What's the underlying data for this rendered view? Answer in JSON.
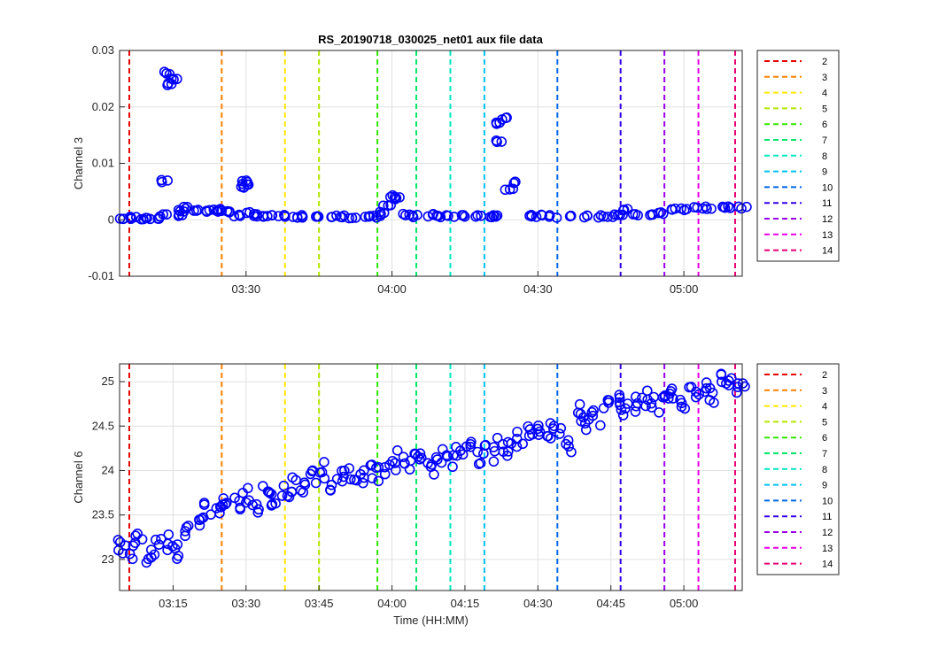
{
  "figure": {
    "title": "RS_20190718_030025_net01 aux file data"
  },
  "colors": {
    "data": "#0000ff",
    "grid": "#e0e0e0",
    "axes": "#262626"
  },
  "legend": {
    "placement": "outside-right",
    "entries": [
      {
        "label": "2",
        "color": "#e60000"
      },
      {
        "label": "3",
        "color": "#ff8000"
      },
      {
        "label": "4",
        "color": "#ffe600"
      },
      {
        "label": "5",
        "color": "#b3e600"
      },
      {
        "label": "6",
        "color": "#33e600"
      },
      {
        "label": "7",
        "color": "#00e666"
      },
      {
        "label": "8",
        "color": "#00e6c2"
      },
      {
        "label": "9",
        "color": "#00c2f0"
      },
      {
        "label": "10",
        "color": "#0066e6"
      },
      {
        "label": "11",
        "color": "#3300e6"
      },
      {
        "label": "12",
        "color": "#9900e6"
      },
      {
        "label": "13",
        "color": "#e600e6"
      },
      {
        "label": "14",
        "color": "#e60073"
      }
    ]
  },
  "chart_data": [
    {
      "type": "scatter",
      "ylabel": "Channel 3",
      "xlabel": "",
      "xlim": [
        "03:04",
        "05:12"
      ],
      "ylim": [
        -0.01,
        0.03
      ],
      "grid": true,
      "xticks": [
        "03:30",
        "04:00",
        "04:30",
        "05:00"
      ],
      "yticks": [
        {
          "value": -0.01,
          "label": "-0.01"
        },
        {
          "value": 0,
          "label": "0"
        },
        {
          "value": 0.01,
          "label": "0.01"
        },
        {
          "value": 0.02,
          "label": "0.02"
        },
        {
          "value": 0.03,
          "label": "0.03"
        }
      ],
      "event_lines": [
        "03:06",
        "03:25",
        "03:38",
        "03:45",
        "03:57",
        "04:05",
        "04:12",
        "04:19",
        "04:34",
        "04:47",
        "04:56",
        "05:03",
        "05:12"
      ],
      "series": [
        {
          "x": [
            "03:04",
            "03:06",
            "03:08",
            "03:10",
            "03:12",
            "03:13",
            "03:13",
            "03:14",
            "03:14",
            "03:15",
            "03:16",
            "03:17",
            "03:18",
            "03:20",
            "03:22",
            "03:24",
            "03:25",
            "03:26",
            "03:28",
            "03:29",
            "03:30",
            "03:30",
            "03:31",
            "03:32",
            "03:34",
            "03:36",
            "03:38",
            "03:40",
            "03:42",
            "03:45",
            "03:48",
            "03:50",
            "03:52",
            "03:55",
            "03:57",
            "03:58",
            "03:59",
            "04:00",
            "04:01",
            "04:03",
            "04:05",
            "04:08",
            "04:10",
            "04:12",
            "04:15",
            "04:18",
            "04:20",
            "04:21",
            "04:22",
            "04:22",
            "04:23",
            "04:24",
            "04:25",
            "04:28",
            "04:30",
            "04:33",
            "04:36",
            "04:40",
            "04:43",
            "04:45",
            "04:47",
            "04:48",
            "04:50",
            "04:53",
            "04:55",
            "04:58",
            "05:00",
            "05:03",
            "05:05",
            "05:08",
            "05:10",
            "05:12"
          ],
          "y": [
            0.0003,
            0.0003,
            0.0003,
            0.0003,
            0.0003,
            0.0008,
            0.0068,
            0.026,
            0.024,
            0.025,
            0.0008,
            0.0015,
            0.0022,
            0.0016,
            0.0016,
            0.0017,
            0.0016,
            0.0015,
            0.0007,
            0.0058,
            0.0062,
            0.0068,
            0.0012,
            0.0008,
            0.0007,
            0.0007,
            0.0007,
            0.0006,
            0.0006,
            0.0006,
            0.0006,
            0.0006,
            0.0005,
            0.0006,
            0.0006,
            0.0012,
            0.0025,
            0.0038,
            0.0042,
            0.0008,
            0.0007,
            0.0008,
            0.0007,
            0.0007,
            0.0007,
            0.0006,
            0.0006,
            0.0006,
            0.017,
            0.014,
            0.018,
            0.0055,
            0.0065,
            0.0008,
            0.0007,
            0.0006,
            0.0006,
            0.0006,
            0.0006,
            0.0007,
            0.0008,
            0.0019,
            0.0009,
            0.0009,
            0.0012,
            0.0019,
            0.0019,
            0.002,
            0.0021,
            0.0021,
            0.0022,
            0.0022
          ]
        }
      ]
    },
    {
      "type": "scatter",
      "ylabel": "Channel 6",
      "xlabel": "Time (HH:MM)",
      "xlim": [
        "03:04",
        "05:12"
      ],
      "ylim": [
        22.65,
        25.2
      ],
      "grid": true,
      "xticks": [
        "03:15",
        "03:30",
        "03:45",
        "04:00",
        "04:15",
        "04:30",
        "04:45",
        "05:00"
      ],
      "yticks": [
        {
          "value": 23,
          "label": "23"
        },
        {
          "value": 23.5,
          "label": "23.5"
        },
        {
          "value": 24,
          "label": "24"
        },
        {
          "value": 24.5,
          "label": "24.5"
        },
        {
          "value": 25,
          "label": "25"
        }
      ],
      "event_lines": [
        "03:06",
        "03:25",
        "03:38",
        "03:45",
        "03:57",
        "04:05",
        "04:12",
        "04:19",
        "04:34",
        "04:47",
        "04:56",
        "05:03",
        "05:12"
      ],
      "series": [
        {
          "x": [
            "03:04",
            "03:06",
            "03:08",
            "03:10",
            "03:12",
            "03:14",
            "03:16",
            "03:18",
            "03:20",
            "03:22",
            "03:24",
            "03:26",
            "03:28",
            "03:30",
            "03:32",
            "03:34",
            "03:36",
            "03:38",
            "03:40",
            "03:42",
            "03:44",
            "03:46",
            "03:48",
            "03:50",
            "03:52",
            "03:54",
            "03:56",
            "03:58",
            "04:00",
            "04:02",
            "04:04",
            "04:06",
            "04:08",
            "04:10",
            "04:12",
            "04:14",
            "04:16",
            "04:18",
            "04:20",
            "04:22",
            "04:24",
            "04:26",
            "04:28",
            "04:30",
            "04:32",
            "04:34",
            "04:36",
            "04:38",
            "04:40",
            "04:42",
            "04:44",
            "04:46",
            "04:48",
            "04:50",
            "04:52",
            "04:54",
            "04:56",
            "04:58",
            "05:00",
            "05:02",
            "05:04",
            "05:06",
            "05:08",
            "05:10",
            "05:12"
          ],
          "y": [
            23.15,
            23.1,
            23.2,
            23.05,
            23.15,
            23.2,
            23.1,
            23.35,
            23.4,
            23.55,
            23.55,
            23.6,
            23.65,
            23.7,
            23.6,
            23.75,
            23.7,
            23.8,
            23.85,
            23.8,
            23.95,
            24.0,
            23.85,
            23.95,
            23.95,
            23.9,
            24.0,
            23.95,
            24.1,
            24.15,
            24.1,
            24.2,
            24.05,
            24.15,
            24.1,
            24.2,
            24.3,
            24.15,
            24.2,
            24.3,
            24.25,
            24.35,
            24.4,
            24.45,
            24.45,
            24.5,
            24.3,
            24.65,
            24.55,
            24.6,
            24.7,
            24.8,
            24.65,
            24.75,
            24.8,
            24.75,
            24.85,
            24.9,
            24.75,
            24.9,
            24.95,
            24.85,
            25.0,
            24.95,
            24.9
          ]
        }
      ]
    }
  ]
}
